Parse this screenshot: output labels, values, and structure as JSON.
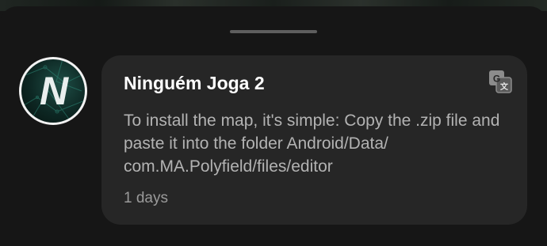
{
  "comment": {
    "author": "Ninguém Joga 2",
    "avatar_letter": "N",
    "message": "To install the map, it's simple: Copy the .zip file and paste it into the folder Android/Data/ com.MA.Polyfield/files/editor",
    "time": "1 days",
    "translate_icon": "translate-icon"
  },
  "colors": {
    "background": "#161616",
    "card": "#262626",
    "title": "#ffffff",
    "message": "#b3b3b3",
    "time": "#9a9a9a",
    "avatar_accent": "#1f4f47"
  }
}
